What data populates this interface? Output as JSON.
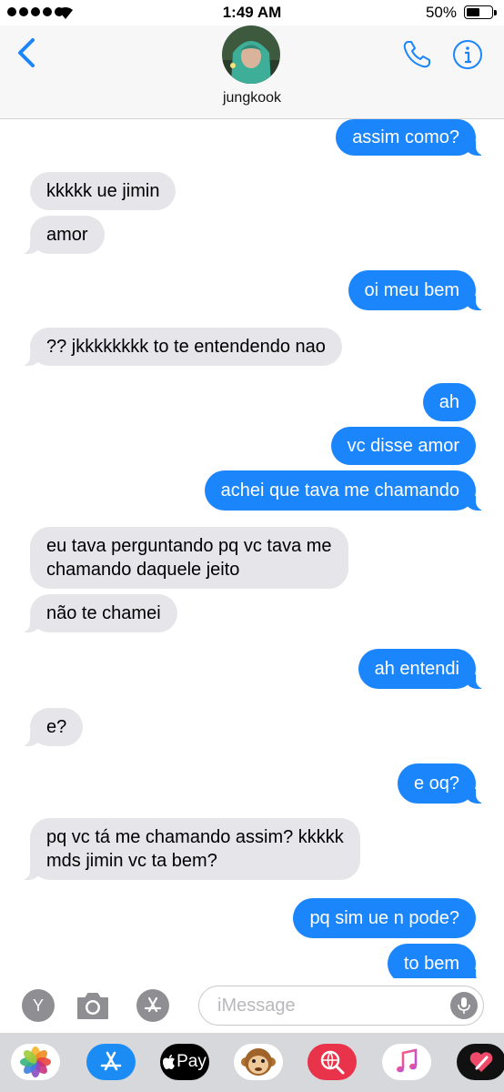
{
  "status_bar": {
    "time": "1:49 AM",
    "battery_percent": "50%",
    "battery_level": 0.5,
    "signal_bars": 5
  },
  "header": {
    "contact_name": "jungkook",
    "back_icon": "chevron-left-icon",
    "call_icon": "phone-icon",
    "info_icon": "info-icon"
  },
  "colors": {
    "outgoing": "#1b85fb",
    "incoming": "#e5e5ea",
    "accent": "#1b85fb"
  },
  "messages": [
    {
      "direction": "out",
      "text": "assim como?"
    },
    {
      "direction": "in",
      "text": "kkkkk ue jimin"
    },
    {
      "direction": "in",
      "text": "amor"
    },
    {
      "direction": "out",
      "text": "oi meu bem"
    },
    {
      "direction": "in",
      "text": "?? jkkkkkkkk to te entendendo nao"
    },
    {
      "direction": "out",
      "text": "ah"
    },
    {
      "direction": "out",
      "text": "vc disse amor"
    },
    {
      "direction": "out",
      "text": "achei que tava me chamando"
    },
    {
      "direction": "in",
      "text": "eu tava perguntando pq vc tava me\nchamando daquele jeito"
    },
    {
      "direction": "in",
      "text": "não te chamei"
    },
    {
      "direction": "out",
      "text": "ah entendi"
    },
    {
      "direction": "in",
      "text": "e?"
    },
    {
      "direction": "out",
      "text": "e oq?"
    },
    {
      "direction": "in",
      "text": "pq vc tá me chamando assim? kkkkk\nmds jimin vc ta bem?"
    },
    {
      "direction": "out",
      "text": "pq sim ue n pode?"
    },
    {
      "direction": "out",
      "text": "to bem"
    }
  ],
  "input_bar": {
    "placeholder": "iMessage",
    "value": "",
    "left_button_label": "Y",
    "camera_icon": "camera-icon",
    "apps_icon": "app-store-icon",
    "mic_icon": "microphone-icon"
  },
  "app_strip": {
    "apple_pay_label": "Pay",
    "icons": [
      "photos-icon",
      "app-store-icon",
      "apple-pay-icon",
      "animoji-monkey-icon",
      "web-search-icon",
      "music-icon",
      "digital-touch-icon"
    ]
  }
}
